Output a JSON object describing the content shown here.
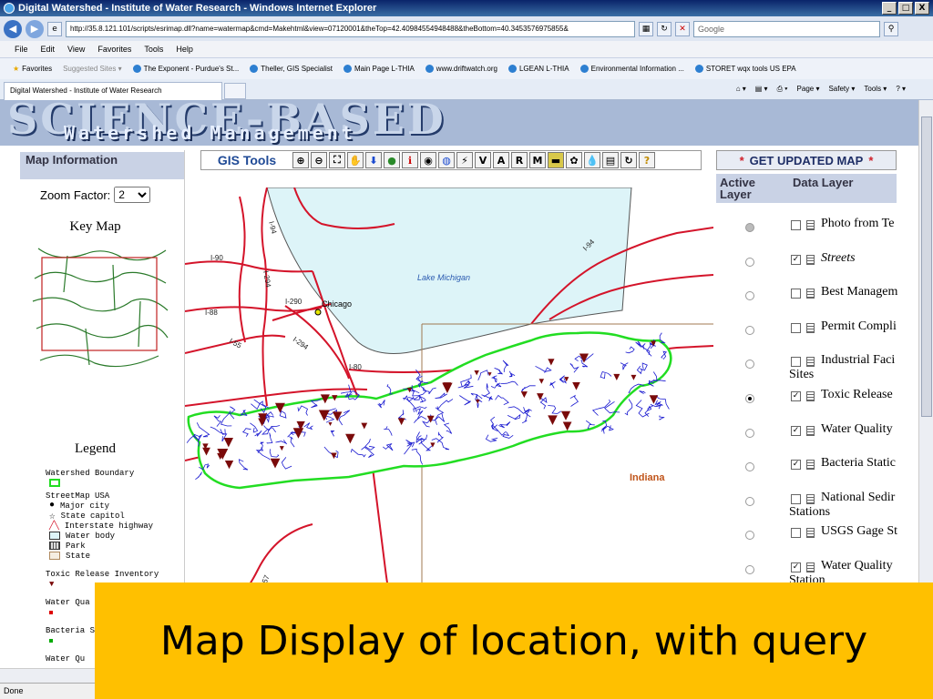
{
  "window": {
    "title": "Digital Watershed - Institute of Water Research - Windows Internet Explorer",
    "buttons": [
      "_",
      "□",
      "X"
    ]
  },
  "address": {
    "url": "http://35.8.121.101/scripts/esrimap.dll?name=watermap&cmd=Makehtml&view=07120001&theTop=42.40984554948488&theBottom=40.3453576975855&",
    "search_placeholder": "Google"
  },
  "menu": [
    "File",
    "Edit",
    "View",
    "Favorites",
    "Tools",
    "Help"
  ],
  "favorites": {
    "label": "Favorites",
    "suggested": "Suggested Sites ▾",
    "items": [
      "The Exponent - Purdue's St...",
      "Theller, GIS Specialist",
      "Main Page L-THIA",
      "www.driftwatch.org",
      "LGEAN L-THIA",
      "Environmental Information ...",
      "STORET wqx tools US EPA"
    ]
  },
  "tab": {
    "label": "Digital Watershed - Institute of Water Research"
  },
  "command_bar": [
    "Page ▾",
    "Safety ▾",
    "Tools ▾"
  ],
  "banner": {
    "top": "SCIENCE-BASED",
    "bottom": "Watershed Management"
  },
  "left_panel": {
    "heading": "Map Information",
    "zoom_label": "Zoom Factor:",
    "zoom_value": "2",
    "key_map_title": "Key Map",
    "legend_title": "Legend",
    "legend": {
      "watershed_boundary": "Watershed Boundary",
      "streetmap": "StreetMap USA",
      "major_city": "Major city",
      "state_capitol": "State capitol",
      "interstate": "Interstate highway",
      "water_body": "Water body",
      "park": "Park",
      "state": "State",
      "tri": "Toxic Release Inventory",
      "water_quality": "Water Qua",
      "bacteria": "Bacteria S",
      "water_q2": "Water Qu"
    }
  },
  "toolbar": {
    "label": "GIS Tools",
    "letters": [
      "V",
      "A",
      "R",
      "M"
    ]
  },
  "map": {
    "lake": "Lake Michigan",
    "city": "Chicago",
    "state": "Indiana",
    "highways": [
      "I-94",
      "I-90",
      "I-294",
      "I-88",
      "I-290",
      "I-55",
      "I-294",
      "I-80",
      "I-94",
      "I-57"
    ]
  },
  "right_panel": {
    "get_map": "GET UPDATED MAP",
    "col_active": "Active Layer",
    "col_data": "Data Layer",
    "layers": [
      {
        "name": "Photo from Te",
        "name2": "",
        "checked": false,
        "active": "dim",
        "italic": false
      },
      {
        "name": "Streets",
        "name2": "",
        "checked": true,
        "active": "off",
        "italic": true
      },
      {
        "name": "Best Managem",
        "name2": "",
        "checked": false,
        "active": "off",
        "italic": false
      },
      {
        "name": "Permit Compli",
        "name2": "",
        "checked": false,
        "active": "off",
        "italic": false
      },
      {
        "name": "Industrial Faci",
        "name2": "Sites",
        "checked": false,
        "active": "off",
        "italic": false
      },
      {
        "name": "Toxic Release",
        "name2": "",
        "checked": true,
        "active": "on",
        "italic": false
      },
      {
        "name": "Water Quality",
        "name2": "",
        "checked": true,
        "active": "off",
        "italic": false
      },
      {
        "name": "Bacteria Static",
        "name2": "",
        "checked": true,
        "active": "off",
        "italic": false
      },
      {
        "name": "National Sedir",
        "name2": "Stations",
        "checked": false,
        "active": "off",
        "italic": false
      },
      {
        "name": "USGS Gage St",
        "name2": "",
        "checked": false,
        "active": "off",
        "italic": false
      },
      {
        "name": "Water Quality",
        "name2": "Station",
        "checked": true,
        "active": "off",
        "italic": false
      }
    ]
  },
  "status": "Done",
  "caption": "Map Display of location, with query",
  "colors": {
    "title_bar": "#0a246a",
    "banner": "#a8b9d6",
    "highway": "#d4142a",
    "lake": "#ddf4f8",
    "stream": "#1a1ad0",
    "watershed": "#22dd22",
    "tri": "#7a0a0a",
    "caption_bg": "#ffc000"
  }
}
